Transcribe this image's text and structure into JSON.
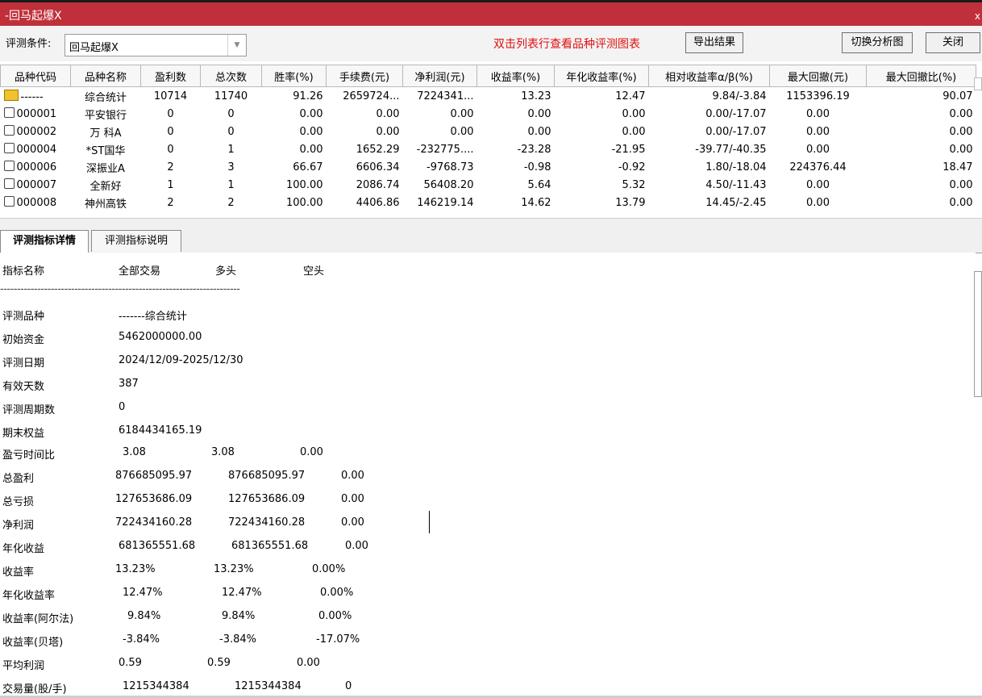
{
  "window": {
    "title": "-回马起爆X",
    "close": "x"
  },
  "toolbar": {
    "condition_label": "评测条件:",
    "condition_value": "回马起爆X",
    "hint": "双击列表行查看品种评测图表",
    "export_label": "导出结果",
    "switch_label": "切换分析图",
    "close_label": "关闭"
  },
  "table": {
    "headers": [
      "品种代码",
      "品种名称",
      "盈利数",
      "总次数",
      "胜率(%)",
      "手续费(元)",
      "净利润(元)",
      "收益率(%)",
      "年化收益率(%)",
      "相对收益率α/β(%)",
      "最大回撤(元)",
      "最大回撤比(%)"
    ],
    "rows": [
      [
        "------",
        "综合统计",
        "10714",
        "11740",
        "91.26",
        "2659724...",
        "7224341...",
        "13.23",
        "12.47",
        "9.84/-3.84",
        "1153396.19",
        "90.07"
      ],
      [
        "000001",
        "平安银行",
        "0",
        "0",
        "0.00",
        "0.00",
        "0.00",
        "0.00",
        "0.00",
        "0.00/-17.07",
        "0.00",
        "0.00"
      ],
      [
        "000002",
        "万 科A",
        "0",
        "0",
        "0.00",
        "0.00",
        "0.00",
        "0.00",
        "0.00",
        "0.00/-17.07",
        "0.00",
        "0.00"
      ],
      [
        "000004",
        "*ST国华",
        "0",
        "1",
        "0.00",
        "1652.29",
        "-232775....",
        "-23.28",
        "-21.95",
        "-39.77/-40.35",
        "0.00",
        "0.00"
      ],
      [
        "000006",
        "深振业A",
        "2",
        "3",
        "66.67",
        "6606.34",
        "-9768.73",
        "-0.98",
        "-0.92",
        "1.80/-18.04",
        "224376.44",
        "18.47"
      ],
      [
        "000007",
        "全新好",
        "1",
        "1",
        "100.00",
        "2086.74",
        "56408.20",
        "5.64",
        "5.32",
        "4.50/-11.43",
        "0.00",
        "0.00"
      ],
      [
        "000008",
        "神州高铁",
        "2",
        "2",
        "100.00",
        "4406.86",
        "146219.14",
        "14.62",
        "13.79",
        "14.45/-2.45",
        "0.00",
        "0.00"
      ]
    ]
  },
  "tabs": [
    "评测指标详情",
    "评测指标说明"
  ],
  "detail": {
    "header": [
      "指标名称",
      "全部交易",
      "多头",
      "空头"
    ],
    "separator": "-----------------------------------------------------------------------",
    "info": [
      [
        "评测品种",
        "-------综合统计"
      ],
      [
        "初始资金",
        "5462000000.00"
      ],
      [
        "评测日期",
        "2024/12/09-2025/12/30"
      ],
      [
        "有效天数",
        "387"
      ],
      [
        "评测周期数",
        "0"
      ],
      [
        "期末权益",
        "6184434165.19"
      ]
    ],
    "metrics": [
      [
        "盈亏时间比",
        "3.08",
        "3.08",
        "0.00"
      ],
      [
        "总盈利",
        "876685095.97",
        "876685095.97",
        "0.00"
      ],
      [
        "总亏损",
        "127653686.09",
        "127653686.09",
        "0.00"
      ],
      [
        "净利润",
        "722434160.28",
        "722434160.28",
        "0.00"
      ],
      [
        "年化收益",
        "681365551.68",
        "681365551.68",
        "0.00"
      ],
      [
        "收益率",
        "13.23%",
        "13.23%",
        "0.00%"
      ],
      [
        "年化收益率",
        "12.47%",
        "12.47%",
        "0.00%"
      ],
      [
        "收益率(阿尔法)",
        "9.84%",
        "9.84%",
        "0.00%"
      ],
      [
        "收益率(贝塔)",
        "-3.84%",
        "-3.84%",
        "-17.07%"
      ],
      [
        "平均利润",
        "0.59",
        "0.59",
        "0.00"
      ],
      [
        "交易量(股/手)",
        "1215344384",
        "1215344384",
        "0"
      ]
    ]
  }
}
